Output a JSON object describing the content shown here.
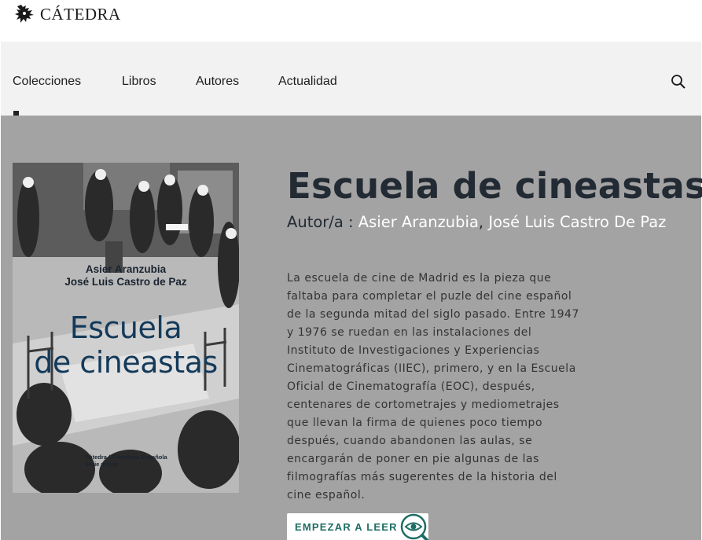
{
  "brand": {
    "name": "CÁTEDRA",
    "logo_icon": "griffin-logo-icon"
  },
  "nav": {
    "items": [
      {
        "label": "Colecciones"
      },
      {
        "label": "Libros"
      },
      {
        "label": "Autores"
      },
      {
        "label": "Actualidad"
      }
    ],
    "search_icon": "search-icon"
  },
  "book": {
    "title": "Escuela de cineastas",
    "author_prefix": "Autor/a : ",
    "authors": [
      "Asier Aranzubia",
      "José Luis Castro De Paz"
    ],
    "author_separator": ", ",
    "description": "La escuela de cine de Madrid es la pieza que faltaba para completar el puzle del cine español de la segunda mitad del siglo pasado. Entre 1947 y 1976 se ruedan en las instalaciones del Instituto de Investigaciones y Experiencias Cinematográficas (IIEC), primero, y en la Escuela Oficial de Cinematografía (EOC), después, centenares de cortometrajes y mediometrajes que llevan la firma de quienes poco tiempo después, cuando abandonen las aulas, se encargarán de poner en pie algunas de las filmografías más sugerentes de la historia del cine español.",
    "cover": {
      "authors_line1": "Asier Aranzubia",
      "authors_line2": "José Luis Castro de Paz",
      "title_line1": "Escuela",
      "title_line2": "de cineastas",
      "publisher_line1": "Cátedra / Filmoteca Española",
      "publisher_line2": "Serie mayor",
      "title_color": "#143a5a"
    }
  },
  "cta": {
    "label": "EMPEZAR A LEER",
    "icon": "eye-magnifier-icon",
    "color": "#1e6e63"
  },
  "colors": {
    "hero_bg": "#a3a3a3",
    "nav_bg": "#f2f2f2",
    "author_link": "#ffffff"
  }
}
